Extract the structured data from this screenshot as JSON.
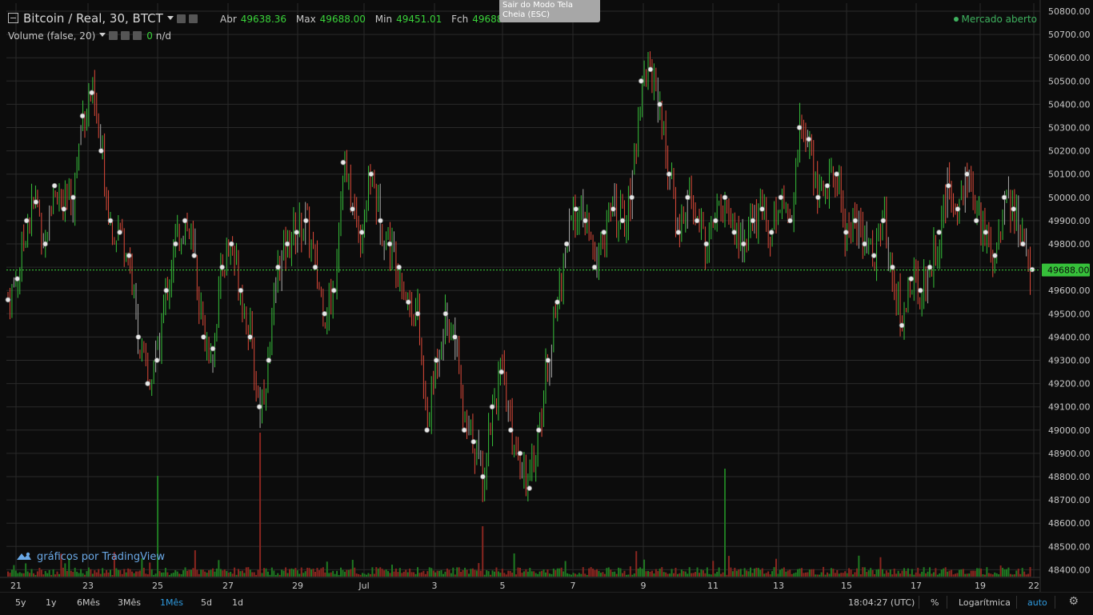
{
  "header": {
    "symbol_title": "Bitcoin / Real, 30, BTCT",
    "ohlc": [
      {
        "k": "Abr",
        "v": "49638.36"
      },
      {
        "k": "Max",
        "v": "49688.00"
      },
      {
        "k": "Min",
        "v": "49451.01"
      },
      {
        "k": "Fch",
        "v": "49688.00"
      }
    ],
    "volume_label": "Volume (false, 20)",
    "volume_value": "0",
    "volume_na": "n/d",
    "market_status": "Mercado aberto"
  },
  "tooltip": {
    "line1": "Sair do Modo Tela",
    "line2": "Cheia (ESC)"
  },
  "brand": "gráficos por TradingView",
  "chart_data": {
    "type": "candlestick",
    "y_ticks": [
      "50800.00",
      "50700.00",
      "50600.00",
      "50500.00",
      "50400.00",
      "50300.00",
      "50200.00",
      "50100.00",
      "50000.00",
      "49900.00",
      "49800.00",
      "49700.00",
      "49600.00",
      "49500.00",
      "49400.00",
      "49300.00",
      "49200.00",
      "49100.00",
      "49000.00",
      "48900.00",
      "48800.00",
      "48700.00",
      "48600.00",
      "48500.00",
      "48400.00"
    ],
    "ylim": [
      48400,
      50800
    ],
    "x_ticks": [
      "21",
      "23",
      "25",
      "27",
      "29",
      "Jul",
      "3",
      "5",
      "7",
      "9",
      "11",
      "13",
      "15",
      "17",
      "19",
      "22"
    ],
    "last_price": "49688.00",
    "close_path": [
      [
        0,
        49560
      ],
      [
        1,
        49650
      ],
      [
        2,
        49900
      ],
      [
        3,
        49980
      ],
      [
        4,
        49800
      ],
      [
        5,
        50050
      ],
      [
        6,
        49950
      ],
      [
        7,
        50000
      ],
      [
        8,
        50350
      ],
      [
        9,
        50450
      ],
      [
        10,
        50200
      ],
      [
        11,
        49900
      ],
      [
        12,
        49850
      ],
      [
        13,
        49750
      ],
      [
        14,
        49400
      ],
      [
        15,
        49200
      ],
      [
        16,
        49300
      ],
      [
        17,
        49600
      ],
      [
        18,
        49800
      ],
      [
        19,
        49900
      ],
      [
        20,
        49750
      ],
      [
        21,
        49400
      ],
      [
        22,
        49350
      ],
      [
        23,
        49700
      ],
      [
        24,
        49800
      ],
      [
        25,
        49600
      ],
      [
        26,
        49400
      ],
      [
        27,
        49100
      ],
      [
        28,
        49300
      ],
      [
        29,
        49700
      ],
      [
        30,
        49800
      ],
      [
        31,
        49850
      ],
      [
        32,
        49900
      ],
      [
        33,
        49700
      ],
      [
        34,
        49500
      ],
      [
        35,
        49600
      ],
      [
        36,
        50150
      ],
      [
        37,
        49950
      ],
      [
        38,
        49850
      ],
      [
        39,
        50100
      ],
      [
        40,
        49900
      ],
      [
        41,
        49800
      ],
      [
        42,
        49700
      ],
      [
        43,
        49550
      ],
      [
        44,
        49500
      ],
      [
        45,
        49000
      ],
      [
        46,
        49300
      ],
      [
        47,
        49500
      ],
      [
        48,
        49400
      ],
      [
        49,
        49000
      ],
      [
        50,
        48950
      ],
      [
        51,
        48800
      ],
      [
        52,
        49100
      ],
      [
        53,
        49250
      ],
      [
        54,
        49000
      ],
      [
        55,
        48900
      ],
      [
        56,
        48750
      ],
      [
        57,
        49000
      ],
      [
        58,
        49300
      ],
      [
        59,
        49550
      ],
      [
        60,
        49800
      ],
      [
        61,
        49950
      ],
      [
        62,
        49900
      ],
      [
        63,
        49700
      ],
      [
        64,
        49850
      ],
      [
        65,
        49950
      ],
      [
        66,
        49900
      ],
      [
        67,
        50000
      ],
      [
        68,
        50500
      ],
      [
        69,
        50550
      ],
      [
        70,
        50400
      ],
      [
        71,
        50100
      ],
      [
        72,
        49850
      ],
      [
        73,
        50000
      ],
      [
        74,
        49900
      ],
      [
        75,
        49800
      ],
      [
        76,
        49900
      ],
      [
        77,
        50000
      ],
      [
        78,
        49850
      ],
      [
        79,
        49800
      ],
      [
        80,
        49900
      ],
      [
        81,
        49950
      ],
      [
        82,
        49850
      ],
      [
        83,
        50000
      ],
      [
        84,
        49900
      ],
      [
        85,
        50300
      ],
      [
        86,
        50250
      ],
      [
        87,
        50000
      ],
      [
        88,
        50050
      ],
      [
        89,
        50100
      ],
      [
        90,
        49850
      ],
      [
        91,
        49900
      ],
      [
        92,
        49800
      ],
      [
        93,
        49750
      ],
      [
        94,
        49900
      ],
      [
        95,
        49700
      ],
      [
        96,
        49450
      ],
      [
        97,
        49650
      ],
      [
        98,
        49600
      ],
      [
        99,
        49700
      ],
      [
        100,
        49850
      ],
      [
        101,
        50050
      ],
      [
        102,
        49950
      ],
      [
        103,
        50100
      ],
      [
        104,
        49900
      ],
      [
        105,
        49850
      ],
      [
        106,
        49750
      ],
      [
        107,
        50000
      ],
      [
        108,
        49950
      ],
      [
        109,
        49800
      ],
      [
        110,
        49690
      ]
    ],
    "volume_spikes": [
      [
        16,
        0.7
      ],
      [
        27,
        1.0
      ],
      [
        51,
        0.35
      ],
      [
        77,
        0.75
      ],
      [
        110,
        0.8
      ]
    ]
  },
  "bottom": {
    "ranges": [
      "5y",
      "1y",
      "6Mês",
      "3Mês",
      "1Mês",
      "5d",
      "1d"
    ],
    "active_range": "1Mês",
    "clock": "18:04:27 (UTC)",
    "percent": "%",
    "log": "Logarítmica",
    "auto": "auto"
  },
  "colors": {
    "up": "#36c03a",
    "down": "#e04a3a",
    "neutral": "#a8a8a8",
    "grid": "#2a2a2a",
    "price_line": "#3ad33a",
    "price_label_bg": "#36c03a"
  }
}
